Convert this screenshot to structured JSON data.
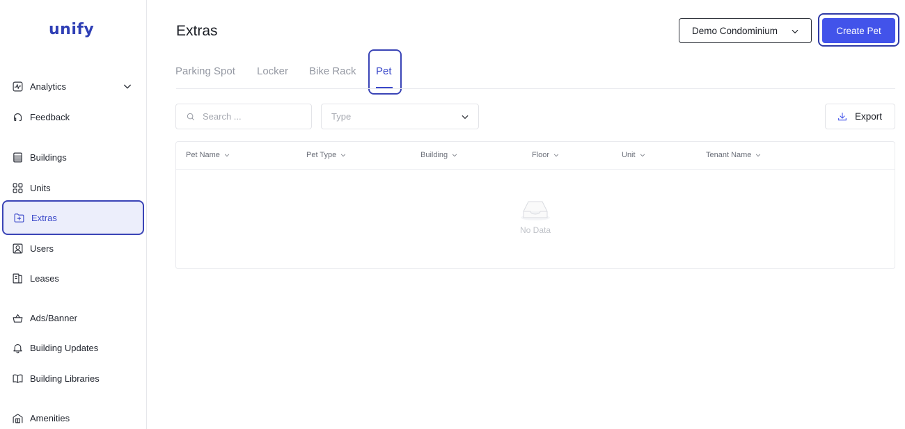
{
  "brand": {
    "logo_text": "unify"
  },
  "sidebar": {
    "items": [
      {
        "label": "Analytics",
        "icon": "activity-icon",
        "has_chevron": true
      },
      {
        "label": "Feedback",
        "icon": "headphones-icon"
      },
      {
        "label": "Buildings",
        "icon": "building-icon"
      },
      {
        "label": "Units",
        "icon": "grid-icon"
      },
      {
        "label": "Extras",
        "icon": "folder-plus-icon",
        "active": true
      },
      {
        "label": "Users",
        "icon": "user-square-icon"
      },
      {
        "label": "Leases",
        "icon": "lease-icon"
      },
      {
        "label": "Ads/Banner",
        "icon": "basket-icon"
      },
      {
        "label": "Building Updates",
        "icon": "bell-icon"
      },
      {
        "label": "Building Libraries",
        "icon": "book-icon"
      },
      {
        "label": "Amenities",
        "icon": "amenity-icon"
      }
    ]
  },
  "header": {
    "title": "Extras",
    "condo_select_value": "Demo Condominium",
    "create_button_label": "Create Pet"
  },
  "tabs": [
    {
      "label": "Parking Spot"
    },
    {
      "label": "Locker"
    },
    {
      "label": "Bike Rack"
    },
    {
      "label": "Pet",
      "active": true
    }
  ],
  "filters": {
    "search_placeholder": "Search ...",
    "type_placeholder": "Type",
    "export_label": "Export"
  },
  "table": {
    "columns": [
      "Pet Name",
      "Pet Type",
      "Building",
      "Floor",
      "Unit",
      "Tenant Name"
    ],
    "empty_text": "No Data"
  },
  "colors": {
    "accent": "#4253ea",
    "highlight_ring": "#3a44b6",
    "active_bg": "#eceefb"
  }
}
